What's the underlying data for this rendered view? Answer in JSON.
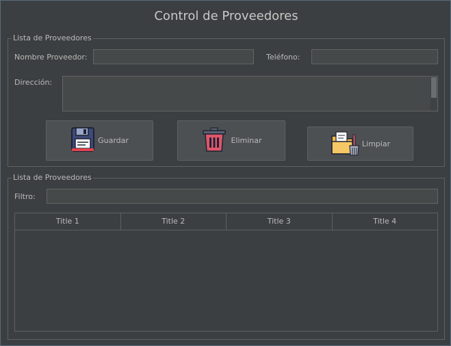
{
  "window": {
    "title": "Control de Proveedores"
  },
  "form_group": {
    "label": "Lista de Proveedores",
    "nombre_label": "Nombre Proveedor:",
    "nombre_value": "",
    "telefono_label": "Teléfono:",
    "telefono_value": "",
    "direccion_label": "Dirección:",
    "direccion_value": ""
  },
  "buttons": {
    "guardar": {
      "label": "Guardar",
      "icon": "floppy-disk-icon"
    },
    "eliminar": {
      "label": "Eliminar",
      "icon": "trash-can-icon"
    },
    "limpiar": {
      "label": "Limpiar",
      "icon": "folder-broom-icon"
    }
  },
  "list_group": {
    "label": "Lista de Proveedores",
    "filtro_label": "Filtro:",
    "filtro_value": ""
  },
  "table": {
    "columns": [
      "Title 1",
      "Title 2",
      "Title 3",
      "Title 4"
    ],
    "rows": []
  },
  "colors": {
    "background": "#3c3f41",
    "field": "#45494a",
    "button": "#4c5052",
    "border": "#5e6060"
  }
}
